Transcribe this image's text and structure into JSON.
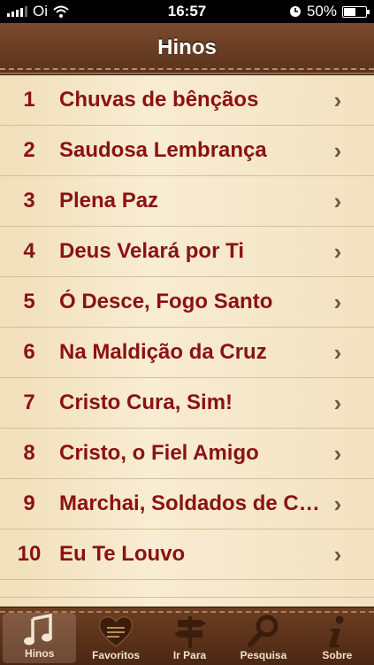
{
  "status": {
    "carrier": "Oi",
    "time": "16:57",
    "battery": "50%",
    "battery_level": 0.5
  },
  "nav": {
    "title": "Hinos"
  },
  "hymns": [
    {
      "num": "1",
      "title": "Chuvas de bênçãos"
    },
    {
      "num": "2",
      "title": "Saudosa Lembrança"
    },
    {
      "num": "3",
      "title": "Plena Paz"
    },
    {
      "num": "4",
      "title": "Deus Velará por Ti"
    },
    {
      "num": "5",
      "title": "Ó Desce, Fogo Santo"
    },
    {
      "num": "6",
      "title": "Na Maldição da Cruz"
    },
    {
      "num": "7",
      "title": "Cristo Cura, Sim!"
    },
    {
      "num": "8",
      "title": "Cristo, o Fiel Amigo"
    },
    {
      "num": "9",
      "title": "Marchai, Soldados de Cristo"
    },
    {
      "num": "10",
      "title": "Eu Te Louvo"
    }
  ],
  "tabs": [
    {
      "label": "Hinos",
      "icon": "music-note-icon"
    },
    {
      "label": "Favoritos",
      "icon": "heart-icon"
    },
    {
      "label": "Ir Para",
      "icon": "signpost-icon"
    },
    {
      "label": "Pesquisa",
      "icon": "magnifier-icon"
    },
    {
      "label": "Sobre",
      "icon": "info-icon"
    }
  ],
  "colors": {
    "accent": "#8a1212",
    "leather": "#5a321b",
    "parchment": "#f3e6c8"
  }
}
